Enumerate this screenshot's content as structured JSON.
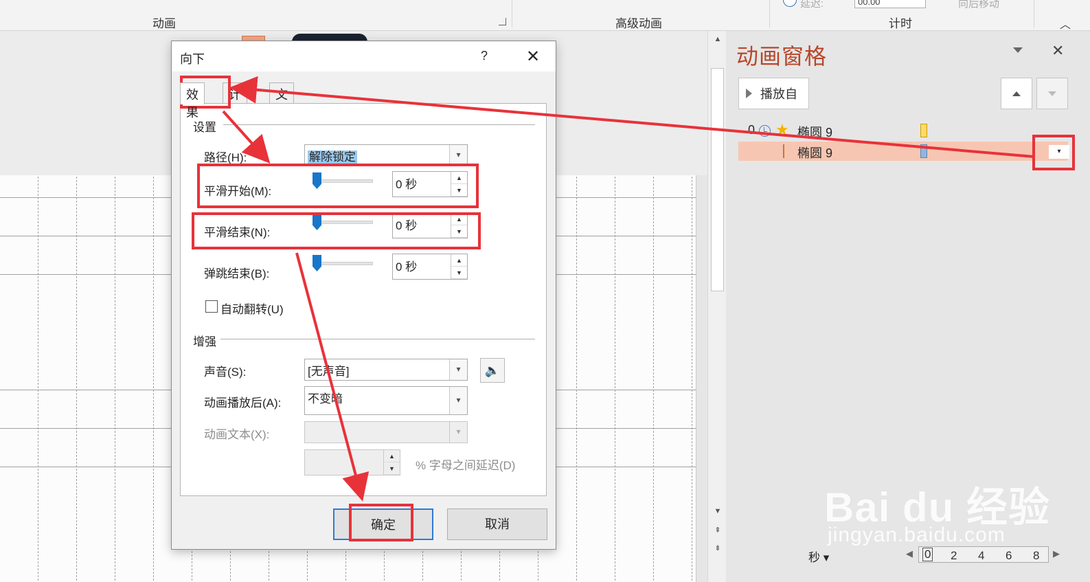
{
  "ribbon": {
    "group_animation": "动画",
    "group_advanced": "高级动画",
    "group_timing": "计时",
    "partial_1": "延迟:",
    "partial_2": "向后移动",
    "input_value": "00.00"
  },
  "pane": {
    "title": "动画窗格",
    "play_label": "播放自",
    "items": [
      {
        "number": "0",
        "name": "椭圆 9"
      },
      {
        "name": "椭圆 9"
      }
    ],
    "timeline": {
      "unit": "秒",
      "ticks": [
        "0",
        "2",
        "4",
        "6",
        "8"
      ]
    }
  },
  "dialog": {
    "title": "向下",
    "help": "?",
    "close": "✕",
    "tabs": [
      "效果",
      "计时",
      "文本动画"
    ],
    "settings_header": "设置",
    "path_label": "路径(H):",
    "path_value": "解除锁定",
    "smooth_start_label": "平滑开始(M):",
    "smooth_start_value": "0 秒",
    "smooth_end_label": "平滑结束(N):",
    "smooth_end_value": "0 秒",
    "bounce_end_label": "弹跳结束(B):",
    "bounce_end_value": "0 秒",
    "auto_reverse_label": "自动翻转(U)",
    "enhance_header": "增强",
    "sound_label": "声音(S):",
    "sound_value": "[无声音]",
    "after_label": "动画播放后(A):",
    "after_value": "不变暗",
    "text_label": "动画文本(X):",
    "delay_label": "% 字母之间延迟(D)",
    "ok": "确定",
    "cancel": "取消"
  },
  "watermark": {
    "line1": "Bai du 经验",
    "line2": "jingyan.baidu.com"
  },
  "colors": {
    "annotation_red": "#e8323a",
    "pane_title": "#b7472a",
    "selected_row": "#f7c6b2",
    "accent_blue": "#1976c9"
  }
}
